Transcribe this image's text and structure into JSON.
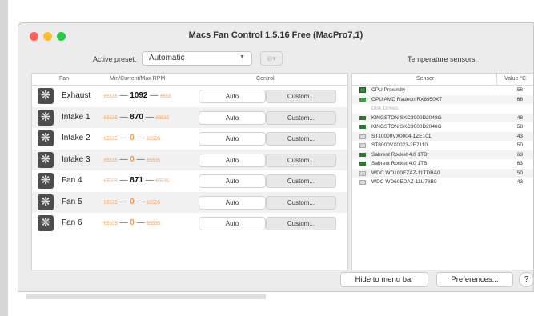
{
  "window": {
    "title": "Macs Fan Control 1.5.16 Free (MacPro7,1)"
  },
  "toolbar": {
    "preset_label": "Active preset:",
    "preset_value": "Automatic",
    "preset_extra": "⊖▾",
    "temp_label": "Temperature sensors:"
  },
  "fan_table": {
    "headers": {
      "fan": "Fan",
      "rpm": "Min/Current/Max RPM",
      "control": "Control"
    },
    "rows": [
      {
        "name": "Exhaust",
        "min": "65535",
        "current": "1092",
        "max": "6553",
        "auto": "Auto",
        "custom": "Custom..."
      },
      {
        "name": "Intake 1",
        "min": "65535",
        "current": "870",
        "max": "65535",
        "auto": "Auto",
        "custom": "Custom..."
      },
      {
        "name": "Intake 2",
        "min": "65535",
        "current": "0",
        "max": "65535",
        "auto": "Auto",
        "custom": "Custom..."
      },
      {
        "name": "Intake 3",
        "min": "65535",
        "current": "0",
        "max": "65535",
        "auto": "Auto",
        "custom": "Custom..."
      },
      {
        "name": "Fan 4",
        "min": "65535",
        "current": "871",
        "max": "65535",
        "auto": "Auto",
        "custom": "Custom..."
      },
      {
        "name": "Fan 5",
        "min": "65535",
        "current": "0",
        "max": "65535",
        "auto": "Auto",
        "custom": "Custom..."
      },
      {
        "name": "Fan 6",
        "min": "65535",
        "current": "0",
        "max": "65535",
        "auto": "Auto",
        "custom": "Custom..."
      }
    ]
  },
  "sensor_table": {
    "headers": {
      "sensor": "Sensor",
      "value": "Value °C"
    },
    "rows": [
      {
        "icon": "cpu-icon",
        "name": "CPU Proximity",
        "value": "58"
      },
      {
        "icon": "gpu-icon",
        "name": "GPU AMD Radeon RX6950XT",
        "value": "68"
      },
      {
        "section": true,
        "name": "Disk Drives:"
      },
      {
        "icon": "ssd-icon",
        "name": "KINGSTON SKC3000D2048G",
        "value": "48"
      },
      {
        "icon": "ssd-icon",
        "name": "KINGSTON SKC3000D2048G",
        "value": "58"
      },
      {
        "icon": "hdd-icon",
        "name": "ST10000VX0004-1ZE101",
        "value": "43"
      },
      {
        "icon": "hdd-icon",
        "name": "ST8000VX0023-2E7110",
        "value": "50"
      },
      {
        "icon": "ssd-icon",
        "name": "Sabrent Rocket 4.0 1TB",
        "value": "63"
      },
      {
        "icon": "ssd-icon",
        "name": "Sabrent Rocket 4.0 1TB",
        "value": "63"
      },
      {
        "icon": "hdd-icon",
        "name": "WDC WD100EZAZ-11TDBA0",
        "value": "50"
      },
      {
        "icon": "hdd-icon",
        "name": "WDC WD60EDAZ-11U78B0",
        "value": "43"
      }
    ]
  },
  "footer": {
    "hide_label": "Hide to menu bar",
    "prefs_label": "Preferences...",
    "help_label": "?"
  },
  "colors": {
    "accent_orange": "#f39a4a",
    "sensor_green": "#2f8a3a"
  }
}
